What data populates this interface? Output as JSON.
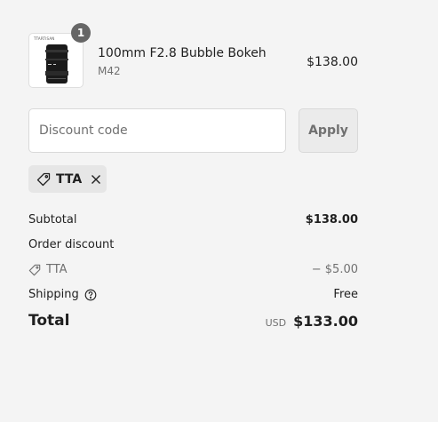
{
  "product": {
    "quantity": "1",
    "name": "100mm F2.8 Bubble Bokeh",
    "variant": "M42",
    "price": "$138.00",
    "thumbnail_brand": "TTARTISAN"
  },
  "discount": {
    "placeholder": "Discount code",
    "value": "",
    "apply_label": "Apply",
    "applied_code": "TTA"
  },
  "summary": {
    "subtotal_label": "Subtotal",
    "subtotal_value": "$138.00",
    "order_discount_label": "Order discount",
    "discount_code": "TTA",
    "discount_value": "− $5.00",
    "shipping_label": "Shipping",
    "shipping_value": "Free",
    "total_label": "Total",
    "currency": "USD",
    "total_value": "$133.00"
  },
  "colors": {
    "background": "#f4f4f4",
    "badge": "#666666",
    "muted_text": "#707070"
  }
}
